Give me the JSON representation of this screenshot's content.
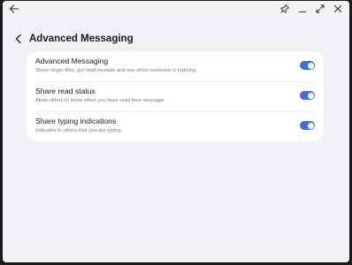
{
  "titlebar": {
    "back_icon": "arrow-left-icon",
    "controls": [
      "pin-icon",
      "minimize-icon",
      "maximize-icon",
      "close-icon"
    ]
  },
  "header": {
    "title": "Advanced Messaging",
    "back_icon": "chevron-left-icon"
  },
  "settings": [
    {
      "title": "Advanced Messaging",
      "description": "Share larger files, get read receipts and see when someone is replying.",
      "enabled": true
    },
    {
      "title": "Share read status",
      "description": "Allow others to know when you have read their message.",
      "enabled": true
    },
    {
      "title": "Share typing indications",
      "description": "Indicates to others that you are typing.",
      "enabled": true
    }
  ],
  "colors": {
    "accent": "#3c6fe0",
    "background": "#f0f0f5",
    "card": "#ffffff"
  }
}
